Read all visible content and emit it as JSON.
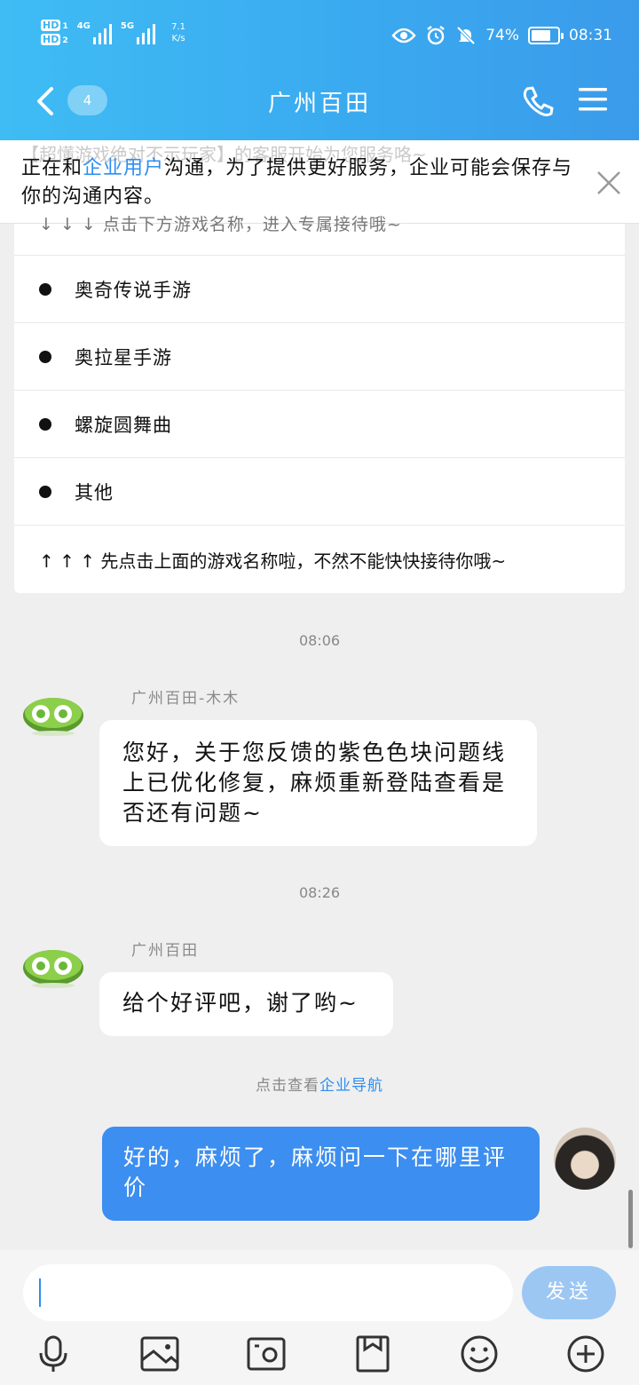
{
  "status_bar": {
    "hd1": "HD",
    "hd1_sub": "1",
    "hd2": "HD",
    "hd2_sub": "2",
    "sig1": "4G",
    "sig2": "5G",
    "speed_value": "7.1",
    "speed_unit": "K/s",
    "battery": "74%",
    "battery_level": 0.74,
    "time": "08:31"
  },
  "nav": {
    "unread_count": "4",
    "title": "广州百田"
  },
  "notice": {
    "ghost_top": "【超懂游戏绝对不示玩家】的客服开始为您服务咯~",
    "text_before": "正在和",
    "link": "企业用户",
    "text_after": "沟通，为了提供更好服务，企业可能会保存与你的沟通内容。"
  },
  "card": {
    "ghost_line": "↓ ↓ ↓ 点击下方游戏名称，进入专属接待哦~",
    "items": [
      "奥奇传说手游",
      "奥拉星手游",
      "螺旋圆舞曲",
      "其他"
    ],
    "footer": "↑ ↑ ↑ 先点击上面的游戏名称啦，不然不能快快接待你哦~"
  },
  "messages": [
    {
      "time": "08:06",
      "sender": "广州百田-木木",
      "text": "您好，关于您反馈的紫色色块问题线上已优化修复，麻烦重新登陆查看是否还有问题~"
    },
    {
      "time": "08:26",
      "sender": "广州百田",
      "text": "给个好评吧，谢了哟~"
    }
  ],
  "hint": {
    "before": "点击查看",
    "link": "企业导航"
  },
  "my_message": "好的，麻烦了，麻烦问一下在哪里评价",
  "input": {
    "send_label": "发送"
  },
  "colors": {
    "header": "#3aaaf0",
    "accent": "#2d8ef0",
    "outgoing_bubble": "#3c8ef0",
    "send_button": "#9dc7f3"
  }
}
